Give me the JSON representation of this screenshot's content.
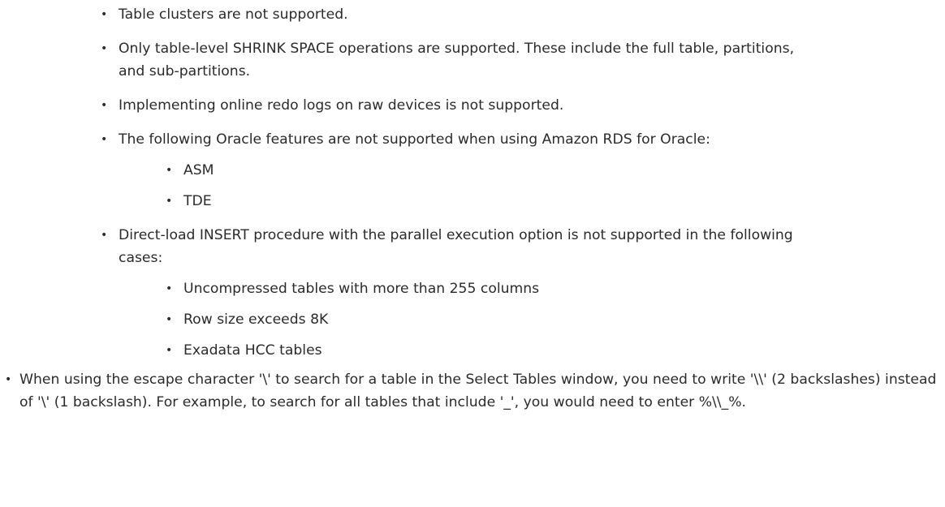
{
  "bullet_char": "•",
  "list": {
    "items": [
      {
        "text": "",
        "sub": [
          "Table clusters are not supported.",
          "Only table-level SHRINK SPACE operations are supported. These include the full table, partitions, and sub-partitions.",
          "Implementing online redo logs on raw devices is not supported.",
          "The following Oracle features are not supported when using Amazon RDS for Oracle:",
          "Direct-load INSERT procedure with the parallel execution option is not supported in the following cases:"
        ],
        "rds_features": [
          "ASM",
          "TDE"
        ],
        "direct_load_cases": [
          "Uncompressed tables with more than 255 columns",
          "Row size exceeds 8K",
          "Exadata HCC tables"
        ]
      },
      {
        "text": "When using the escape character '\\' to search for a table in the Select Tables window, you need to write '\\\\' (2 backslashes) instead of '\\' (1 backslash). For example, to search for all tables that include '_', you would need to enter %\\\\_%."
      }
    ]
  }
}
